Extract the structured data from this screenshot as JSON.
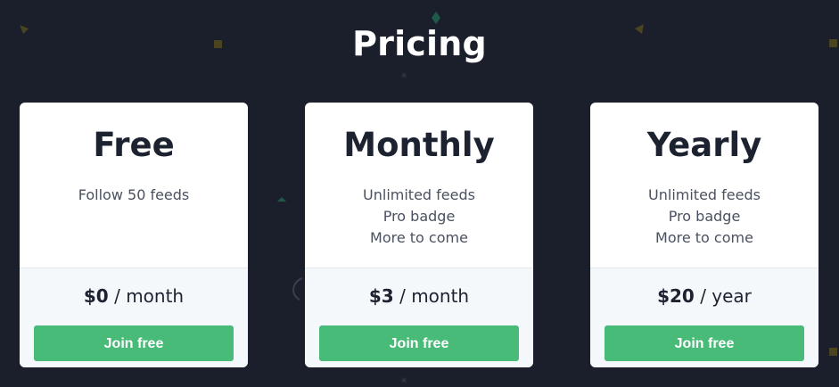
{
  "page": {
    "title": "Pricing"
  },
  "plans": [
    {
      "name": "Free",
      "features": [
        "Follow 50 feeds"
      ],
      "price_amount": "$0",
      "price_period": "/ month",
      "button_label": "Join free"
    },
    {
      "name": "Monthly",
      "features": [
        "Unlimited feeds",
        "Pro badge",
        "More to come"
      ],
      "price_amount": "$3",
      "price_period": "/ month",
      "button_label": "Join free"
    },
    {
      "name": "Yearly",
      "features": [
        "Unlimited feeds",
        "Pro badge",
        "More to come"
      ],
      "price_amount": "$20",
      "price_period": "/ year",
      "button_label": "Join free"
    }
  ],
  "colors": {
    "background": "#1b1f2b",
    "card": "#ffffff",
    "card_footer": "#f5f8fb",
    "button": "#48bb78",
    "button_text": "#ffffff",
    "text_dark": "#1d2230",
    "text_muted": "#4a5160",
    "decoration_gold": "#4a4420",
    "decoration_green": "#1f5a48"
  }
}
